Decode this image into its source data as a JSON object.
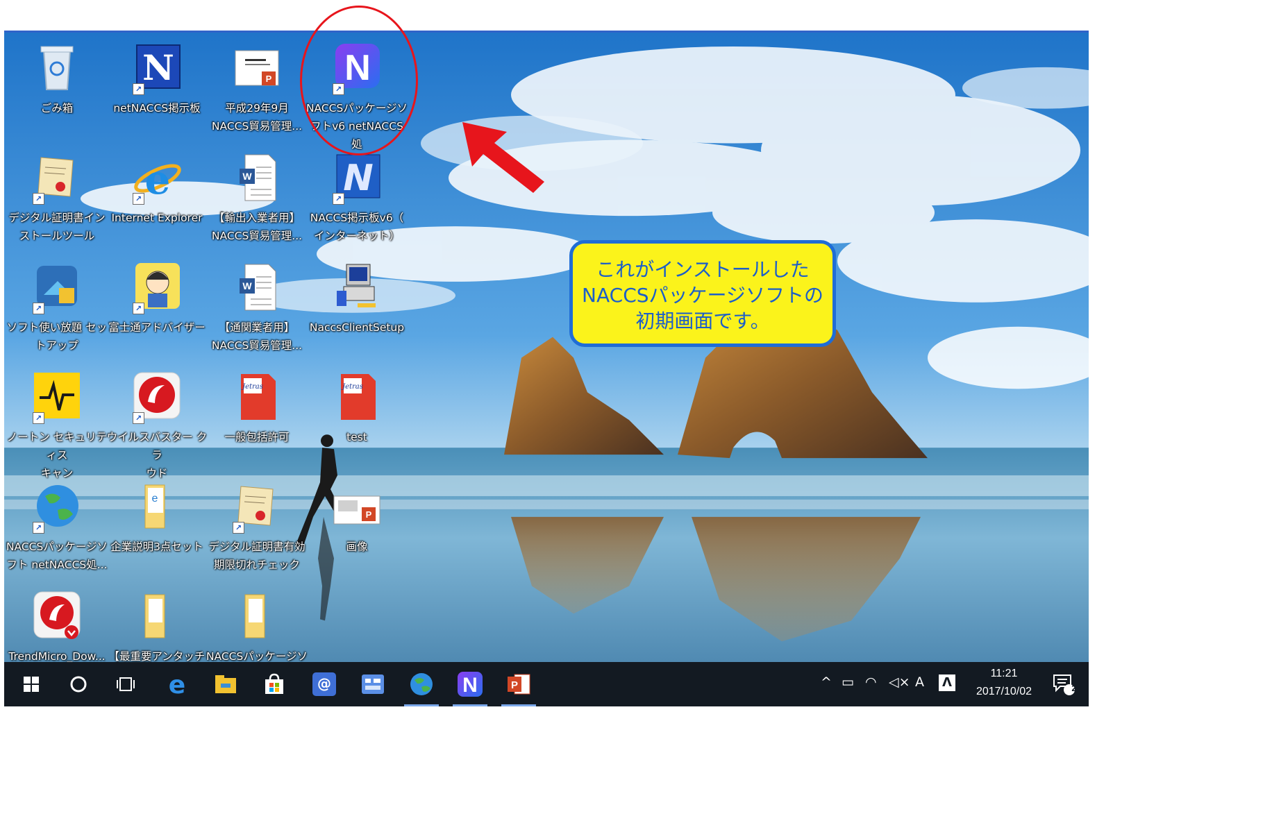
{
  "desktop": {
    "icons": [
      {
        "label": "ごみ箱"
      },
      {
        "label": "netNACCS掲示板"
      },
      {
        "label": "平成29年9月\nNACCS貿易管理..."
      },
      {
        "label": "NACCSパッケージソ\nフトv6 netNACCS処\n理方式"
      },
      {
        "label": "デジタル証明書イン\nストールツール"
      },
      {
        "label": "Internet Explorer"
      },
      {
        "label": "【輸出入業者用】\nNACCS貿易管理..."
      },
      {
        "label": "NACCS掲示板v6（\nインターネット）"
      },
      {
        "label": "ソフト使い放題 セッ\nトアップ"
      },
      {
        "label": "富士通アドバイザー"
      },
      {
        "label": "【通関業者用】\nNACCS貿易管理..."
      },
      {
        "label": "NaccsClientSetup"
      },
      {
        "label": "ノートン セキュリティス\nキャン"
      },
      {
        "label": "ウイルスバスター クラ\nウド"
      },
      {
        "label": "一般包括許可"
      },
      {
        "label": "test"
      },
      {
        "label": "NACCSパッケージソ\nフト netNACCS処..."
      },
      {
        "label": "企業説明3点セット"
      },
      {
        "label": "デジタル証明書有効\n期限切れチェック"
      },
      {
        "label": "画像"
      },
      {
        "label": "TrendMicro_Dow..."
      },
      {
        "label": "【最重要アンタッチャ"
      },
      {
        "label": "NACCSパッケージソ"
      }
    ]
  },
  "callout": {
    "line1": "これがインストールした",
    "line2": "NACCSパッケージソフトの",
    "line3": "初期画面です。"
  },
  "taskbar": {
    "clock_time": "11:21",
    "clock_date": "2017/10/02",
    "notification_count": "2",
    "ime_label": "A"
  },
  "colors": {
    "annotation_red": "#e7151c",
    "callout_fill": "#fbf31b",
    "callout_border": "#1f6dd6",
    "taskbar": "#131a22"
  }
}
